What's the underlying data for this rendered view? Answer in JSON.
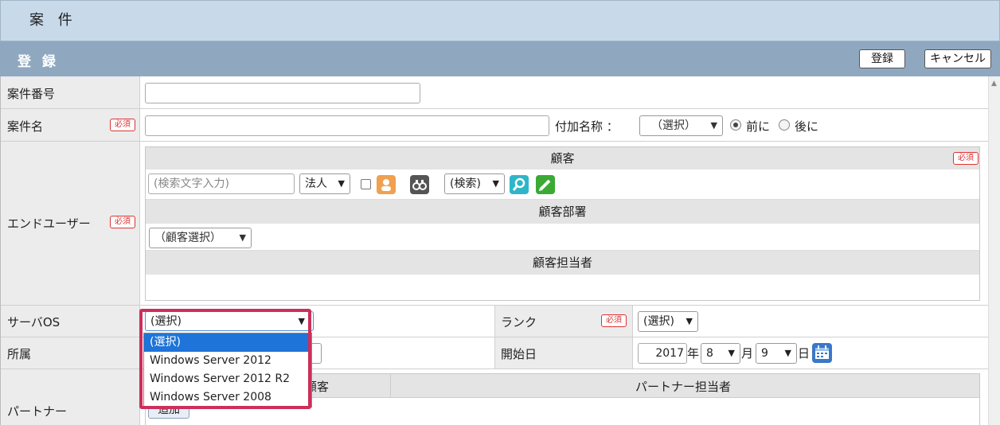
{
  "header": {
    "title": "案 件"
  },
  "section": {
    "title": "登 録",
    "register_label": "登録",
    "cancel_label": "キャンセル"
  },
  "required_label": "必須",
  "fields": {
    "case_number": {
      "label": "案件番号"
    },
    "case_name": {
      "label": "案件名",
      "suffix_label": "付加名称 ：",
      "suffix_select": "（選択）",
      "radio_before": "前に",
      "radio_after": "後に"
    },
    "end_user": {
      "label": "エンドユーザー",
      "customer_header": "顧客",
      "search_placeholder": "(検索文字入力)",
      "type_select": "法人",
      "search_select": "(検索)",
      "department_header": "顧客部署",
      "department_select": "（顧客選択）",
      "contact_header": "顧客担当者"
    },
    "server_os": {
      "label": "サーバOS",
      "selected": "(選択)",
      "options": [
        "(選択)",
        "Windows Server 2012",
        "Windows Server 2012 R2",
        "Windows Server 2008"
      ]
    },
    "rank": {
      "label": "ランク",
      "selected": "(選択)"
    },
    "affiliation": {
      "label": "所属"
    },
    "start_date": {
      "label": "開始日",
      "year": "2017",
      "year_unit": "年",
      "month": "8",
      "month_unit": "月",
      "day": "9",
      "day_unit": "日"
    },
    "partner": {
      "label": "パートナー",
      "customer_header_partial": "顧客",
      "contact_header": "パートナー担当者",
      "add_label": "追加"
    }
  },
  "colors": {
    "accent": "#1e74d8",
    "required": "#d33333",
    "highlight": "#cc2f5a",
    "section": "#8fa8c0",
    "header": "#c8daea"
  }
}
